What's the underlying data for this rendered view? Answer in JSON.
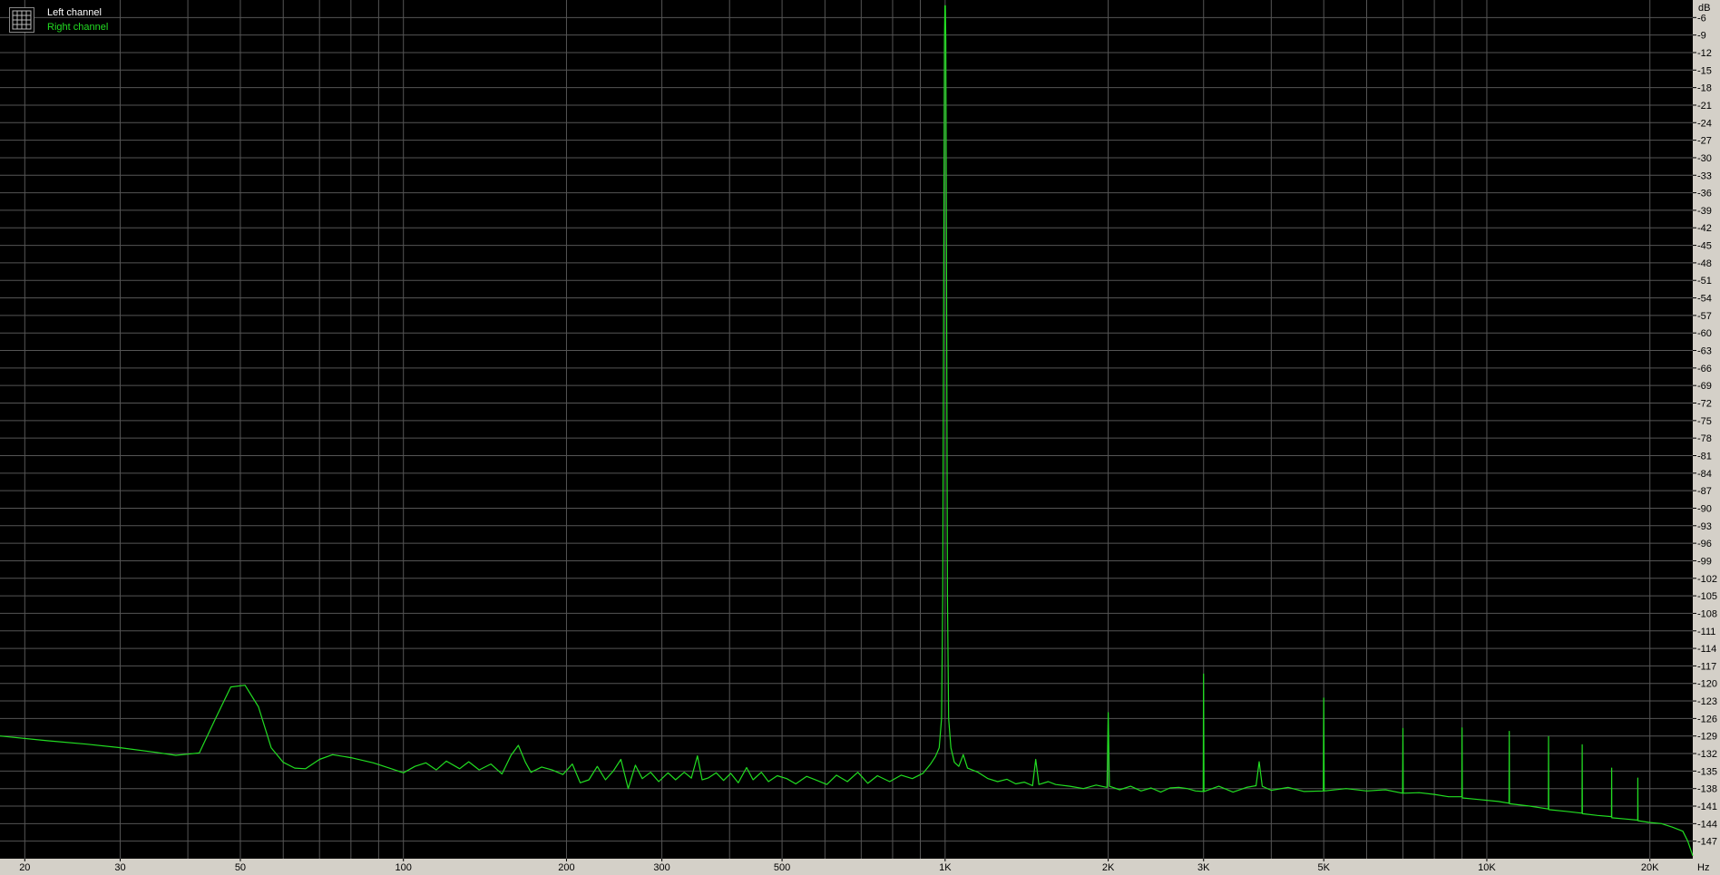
{
  "chart_data": {
    "type": "line",
    "xscale": "log",
    "xlim": [
      18,
      24000
    ],
    "ylim": [
      -150,
      -3
    ],
    "xunit": "Hz",
    "yunit": "dB",
    "x_tick_labels": [
      {
        "v": 20,
        "t": "20"
      },
      {
        "v": 30,
        "t": "30"
      },
      {
        "v": 50,
        "t": "50"
      },
      {
        "v": 100,
        "t": "100"
      },
      {
        "v": 200,
        "t": "200"
      },
      {
        "v": 300,
        "t": "300"
      },
      {
        "v": 500,
        "t": "500"
      },
      {
        "v": 1000,
        "t": "1K"
      },
      {
        "v": 2000,
        "t": "2K"
      },
      {
        "v": 3000,
        "t": "3K"
      },
      {
        "v": 5000,
        "t": "5K"
      },
      {
        "v": 10000,
        "t": "10K"
      },
      {
        "v": 20000,
        "t": "20K"
      }
    ],
    "y_ticks": [
      -6,
      -9,
      -12,
      -15,
      -18,
      -21,
      -24,
      -27,
      -30,
      -33,
      -36,
      -39,
      -42,
      -45,
      -48,
      -51,
      -54,
      -57,
      -60,
      -63,
      -66,
      -69,
      -72,
      -75,
      -78,
      -81,
      -84,
      -87,
      -90,
      -93,
      -96,
      -99,
      -102,
      -105,
      -108,
      -111,
      -114,
      -117,
      -120,
      -123,
      -126,
      -129,
      -132,
      -135,
      -138,
      -141,
      -144,
      -147
    ],
    "grid": true,
    "legend_position": "top-left",
    "colors": {
      "background": "#000000",
      "grid": "#555555",
      "right": "#22dd22",
      "left": "#ffffff"
    },
    "series": [
      {
        "name": "Left channel",
        "color": "#ffffff",
        "points": []
      },
      {
        "name": "Right channel",
        "color": "#22dd22",
        "points": [
          [
            18,
            -129
          ],
          [
            22,
            -129.8
          ],
          [
            26,
            -130.4
          ],
          [
            30,
            -131
          ],
          [
            35,
            -131.8
          ],
          [
            38,
            -132.3
          ],
          [
            40,
            -132.1
          ],
          [
            42,
            -131.9
          ],
          [
            45,
            -126
          ],
          [
            48,
            -120.6
          ],
          [
            51,
            -120.3
          ],
          [
            54,
            -124
          ],
          [
            57,
            -131
          ],
          [
            60,
            -133.5
          ],
          [
            63,
            -134.5
          ],
          [
            66,
            -134.6
          ],
          [
            70,
            -133
          ],
          [
            74,
            -132.2
          ],
          [
            80,
            -132.7
          ],
          [
            88,
            -133.6
          ],
          [
            95,
            -134.6
          ],
          [
            100,
            -135.3
          ],
          [
            105,
            -134.2
          ],
          [
            110,
            -133.6
          ],
          [
            115,
            -134.8
          ],
          [
            120,
            -133.3
          ],
          [
            127,
            -134.6
          ],
          [
            132,
            -133.4
          ],
          [
            138,
            -134.8
          ],
          [
            145,
            -133.8
          ],
          [
            152,
            -135.5
          ],
          [
            158,
            -132.3
          ],
          [
            163,
            -130.6
          ],
          [
            168,
            -133.5
          ],
          [
            172,
            -135.2
          ],
          [
            180,
            -134.3
          ],
          [
            188,
            -134.8
          ],
          [
            197,
            -135.6
          ],
          [
            205,
            -133.8
          ],
          [
            212,
            -137
          ],
          [
            220,
            -136.5
          ],
          [
            228,
            -134.2
          ],
          [
            236,
            -136.5
          ],
          [
            244,
            -135
          ],
          [
            252,
            -133
          ],
          [
            260,
            -138
          ],
          [
            268,
            -134
          ],
          [
            276,
            -136.3
          ],
          [
            286,
            -135.2
          ],
          [
            296,
            -136.8
          ],
          [
            308,
            -135.3
          ],
          [
            318,
            -136.5
          ],
          [
            330,
            -135.2
          ],
          [
            340,
            -136.2
          ],
          [
            349,
            -132.4
          ],
          [
            356,
            -136.5
          ],
          [
            365,
            -136.2
          ],
          [
            378,
            -135.3
          ],
          [
            390,
            -136.6
          ],
          [
            402,
            -135.4
          ],
          [
            415,
            -137
          ],
          [
            430,
            -134.4
          ],
          [
            442,
            -136.5
          ],
          [
            458,
            -135.2
          ],
          [
            472,
            -136.8
          ],
          [
            490,
            -135.8
          ],
          [
            510,
            -136.3
          ],
          [
            530,
            -137.2
          ],
          [
            555,
            -135.9
          ],
          [
            580,
            -136.6
          ],
          [
            605,
            -137.3
          ],
          [
            630,
            -135.7
          ],
          [
            660,
            -136.8
          ],
          [
            690,
            -135.2
          ],
          [
            720,
            -137.1
          ],
          [
            750,
            -135.8
          ],
          [
            790,
            -136.8
          ],
          [
            830,
            -135.7
          ],
          [
            870,
            -136.3
          ],
          [
            910,
            -135.4
          ],
          [
            940,
            -133.8
          ],
          [
            960,
            -132.5
          ],
          [
            975,
            -131
          ],
          [
            985,
            -126
          ],
          [
            990,
            -105
          ],
          [
            994,
            -50
          ],
          [
            997,
            -10
          ],
          [
            999,
            -4
          ],
          [
            1001,
            -4
          ],
          [
            1003,
            -10
          ],
          [
            1006,
            -50
          ],
          [
            1010,
            -105
          ],
          [
            1015,
            -126
          ],
          [
            1025,
            -131
          ],
          [
            1040,
            -133.5
          ],
          [
            1060,
            -134.2
          ],
          [
            1080,
            -132.2
          ],
          [
            1100,
            -134.5
          ],
          [
            1150,
            -135.2
          ],
          [
            1200,
            -136.3
          ],
          [
            1250,
            -136.8
          ],
          [
            1300,
            -136.4
          ],
          [
            1350,
            -137.2
          ],
          [
            1400,
            -136.9
          ],
          [
            1450,
            -137.5
          ],
          [
            1470,
            -133
          ],
          [
            1490,
            -137.3
          ],
          [
            1550,
            -136.8
          ],
          [
            1600,
            -137.3
          ],
          [
            1700,
            -137.6
          ],
          [
            1800,
            -138
          ],
          [
            1900,
            -137.4
          ],
          [
            1990,
            -137.8
          ],
          [
            2000,
            -125
          ],
          [
            2010,
            -137.6
          ],
          [
            2100,
            -138.2
          ],
          [
            2200,
            -137.6
          ],
          [
            2300,
            -138.4
          ],
          [
            2400,
            -137.9
          ],
          [
            2500,
            -138.6
          ],
          [
            2600,
            -137.9
          ],
          [
            2700,
            -137.8
          ],
          [
            2800,
            -138
          ],
          [
            2900,
            -138.4
          ],
          [
            2995,
            -138.5
          ],
          [
            3000,
            -118.4
          ],
          [
            3005,
            -138.5
          ],
          [
            3200,
            -137.6
          ],
          [
            3400,
            -138.6
          ],
          [
            3600,
            -137.8
          ],
          [
            3750,
            -137.5
          ],
          [
            3800,
            -133.4
          ],
          [
            3850,
            -137.6
          ],
          [
            4000,
            -138.3
          ],
          [
            4300,
            -137.8
          ],
          [
            4600,
            -138.5
          ],
          [
            4990,
            -138.4
          ],
          [
            5000,
            -122.5
          ],
          [
            5010,
            -138.4
          ],
          [
            5500,
            -138
          ],
          [
            6000,
            -138.4
          ],
          [
            6500,
            -138.2
          ],
          [
            6990,
            -138.8
          ],
          [
            7000,
            -127.7
          ],
          [
            7010,
            -138.8
          ],
          [
            7500,
            -138.7
          ],
          [
            8000,
            -139
          ],
          [
            8500,
            -139.4
          ],
          [
            8990,
            -139.4
          ],
          [
            9000,
            -127.6
          ],
          [
            9010,
            -139.6
          ],
          [
            9500,
            -139.8
          ],
          [
            10500,
            -140.2
          ],
          [
            10990,
            -140.5
          ],
          [
            11000,
            -128.2
          ],
          [
            11010,
            -140.6
          ],
          [
            12000,
            -141
          ],
          [
            12990,
            -141.5
          ],
          [
            13000,
            -129.1
          ],
          [
            13010,
            -141.6
          ],
          [
            14000,
            -141.9
          ],
          [
            14990,
            -142.2
          ],
          [
            15000,
            -130.5
          ],
          [
            15010,
            -142.3
          ],
          [
            16000,
            -142.6
          ],
          [
            16990,
            -142.8
          ],
          [
            17000,
            -134.5
          ],
          [
            17010,
            -143
          ],
          [
            18000,
            -143.2
          ],
          [
            18990,
            -143.4
          ],
          [
            19000,
            -136.2
          ],
          [
            19010,
            -143.5
          ],
          [
            20000,
            -143.8
          ],
          [
            21000,
            -144
          ],
          [
            22000,
            -144.6
          ],
          [
            23000,
            -145.3
          ],
          [
            23500,
            -147
          ],
          [
            24000,
            -149.5
          ]
        ]
      }
    ]
  }
}
